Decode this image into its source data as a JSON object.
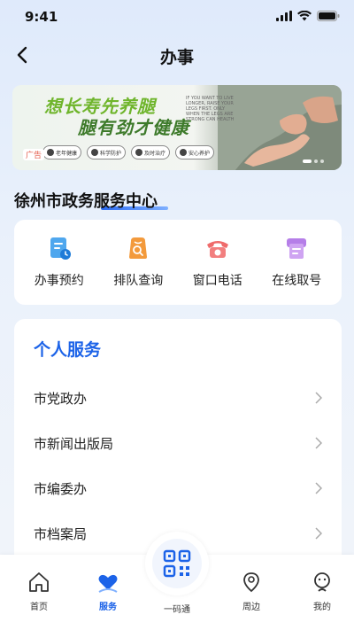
{
  "status_bar": {
    "time": "9:41"
  },
  "nav": {
    "title": "办事"
  },
  "banner": {
    "title_line1": "想长寿先养腿",
    "title_line2": "腿有劲才健康",
    "small_text": "IF YOU WANT TO LIVE LONGER, RAISE YOUR LEGS FIRST. ONLY WHEN THE LEGS ARE STRONG CAN HEALTH",
    "ad_tag": "广告",
    "features": [
      "老年健康",
      "科学防护",
      "及时治疗",
      "安心养护"
    ]
  },
  "center": {
    "title": "徐州市政务服务中心"
  },
  "quick_actions": [
    {
      "label": "办事预约",
      "icon": "calendar-doc-icon"
    },
    {
      "label": "排队查询",
      "icon": "queue-search-icon"
    },
    {
      "label": "窗口电话",
      "icon": "telephone-icon"
    },
    {
      "label": "在线取号",
      "icon": "ticket-printer-icon"
    }
  ],
  "personal_service": {
    "title": "个人服务",
    "items": [
      "市党政办",
      "市新闻出版局",
      "市编委办",
      "市档案局"
    ]
  },
  "tab_bar": {
    "tabs": [
      {
        "label": "首页",
        "icon": "home-icon"
      },
      {
        "label": "服务",
        "icon": "service-heart-icon"
      },
      {
        "label": "一码通",
        "icon": "qr-code-icon"
      },
      {
        "label": "周边",
        "icon": "location-icon"
      },
      {
        "label": "我的",
        "icon": "profile-icon"
      }
    ],
    "active": "服务"
  },
  "colors": {
    "accent": "#1c63e8",
    "banner_green": "#6fb52c",
    "background": "#e9f0fb"
  }
}
